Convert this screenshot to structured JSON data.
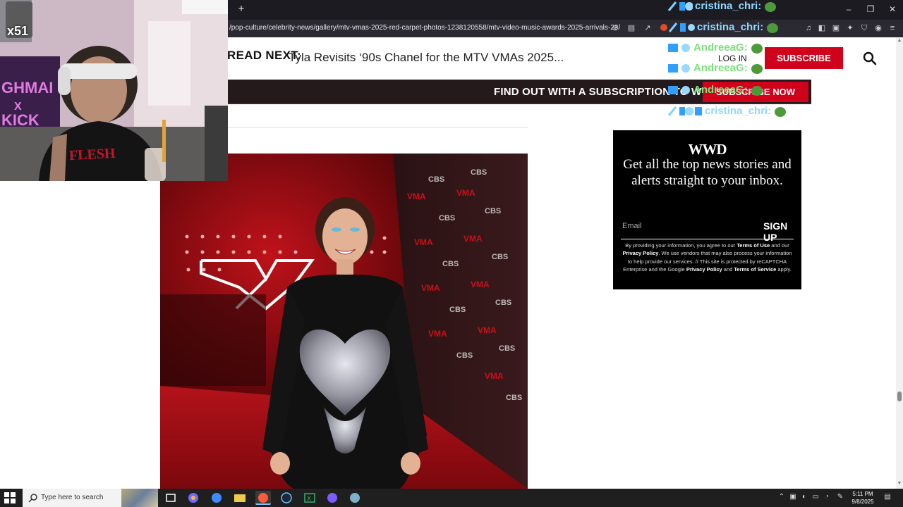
{
  "browser": {
    "new_tab_label": "+",
    "url": "/pop-culture/celebrity-news/gallery/mtv-vmas-2025-red-carpet-photos-1238120558/mtv-video-music-awards-2025-arrivals-23/",
    "window_controls": {
      "minimize": "–",
      "restore": "❐",
      "close": "✕"
    }
  },
  "header": {
    "read_next_label": "READ NEXT:",
    "read_next_title": "Tyla Revisits ‘90s Chanel for the MTV VMAs 2025...",
    "login_label": "LOG IN",
    "subscribe_label": "SUBSCRIBE"
  },
  "promo": {
    "text": "FIND OUT WITH A SUBSCRIPTION TO WWD",
    "cta": "SUBSCRIBE NOW"
  },
  "newsletter": {
    "logo": "WWD",
    "headline": "Get all the top news stories and alerts straight to your inbox.",
    "email_placeholder": "Email",
    "signup_label": "SIGN UP",
    "legal_1": "By providing your information, you agree to our ",
    "legal_terms_use": "Terms of Use",
    "legal_2": " and our ",
    "legal_privacy": "Privacy Policy",
    "legal_3": ". We use vendors that may also process your information to help provide our services. // This site is protected by reCAPTCHA Enterprise and the Google ",
    "legal_privacy2": "Privacy Policy",
    "legal_4": " and ",
    "legal_terms_service": "Terms of Service",
    "legal_5": " apply."
  },
  "webcam": {
    "counter": "x51",
    "sign_text": "GHMAI X KICK"
  },
  "chat_overlay": [
    {
      "user": "cristina_chri:",
      "color": "#8fd8ff"
    },
    {
      "user": "cristina_chri:",
      "color": "#8fd8ff"
    },
    {
      "user": "AndreeaG:",
      "color": "#7de07d"
    },
    {
      "user": "AndreeaG:",
      "color": "#7de07d"
    },
    {
      "user": "AndreeaG:",
      "color": "#7de07d"
    },
    {
      "user": "cristina_chri:",
      "color": "#8fd8ff"
    }
  ],
  "taskbar": {
    "search_placeholder": "Type here to search",
    "time": "5:11 PM",
    "date": "9/8/2025"
  },
  "colors": {
    "brand_red": "#d0021b",
    "chrome_dark": "#1c1b22",
    "urlbar": "#2b2a33"
  }
}
